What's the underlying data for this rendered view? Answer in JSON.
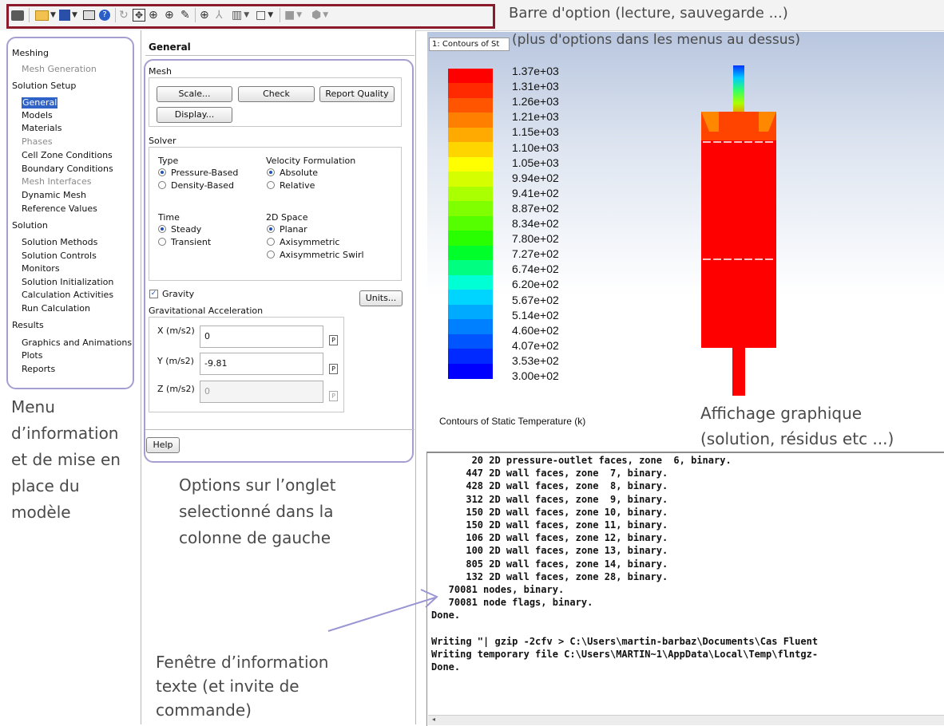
{
  "toolbar": {
    "annotation": "Barre d'option (lecture, sauvegarde ...)",
    "icons": [
      "open-icon",
      "save-icon",
      "screenshot-icon",
      "help-icon",
      "rotate-icon",
      "pan-icon",
      "zoom-fit-icon",
      "zoom-icon",
      "probe-icon",
      "zoom-area-icon",
      "mesh-icon",
      "layout-icon",
      "window-icon",
      "display-icon",
      "view-icon"
    ]
  },
  "nav": {
    "items": [
      {
        "label": "Meshing",
        "kind": "header"
      },
      {
        "label": "Mesh Generation",
        "kind": "dim"
      },
      {
        "label": "Solution Setup",
        "kind": "header"
      },
      {
        "label": "General",
        "kind": "selected"
      },
      {
        "label": "Models",
        "kind": "item"
      },
      {
        "label": "Materials",
        "kind": "item"
      },
      {
        "label": "Phases",
        "kind": "dim"
      },
      {
        "label": "Cell Zone Conditions",
        "kind": "item"
      },
      {
        "label": "Boundary Conditions",
        "kind": "item"
      },
      {
        "label": "Mesh Interfaces",
        "kind": "dim"
      },
      {
        "label": "Dynamic Mesh",
        "kind": "item"
      },
      {
        "label": "Reference Values",
        "kind": "item"
      },
      {
        "label": "Solution",
        "kind": "header"
      },
      {
        "label": "Solution Methods",
        "kind": "item"
      },
      {
        "label": "Solution Controls",
        "kind": "item"
      },
      {
        "label": "Monitors",
        "kind": "item"
      },
      {
        "label": "Solution Initialization",
        "kind": "item"
      },
      {
        "label": "Calculation Activities",
        "kind": "item"
      },
      {
        "label": "Run Calculation",
        "kind": "item"
      },
      {
        "label": "Results",
        "kind": "header"
      },
      {
        "label": "Graphics and Animations",
        "kind": "item"
      },
      {
        "label": "Plots",
        "kind": "item"
      },
      {
        "label": "Reports",
        "kind": "item"
      }
    ],
    "annotation_lines": [
      "Menu",
      "d’information",
      "et de mise en",
      "place du",
      "modèle"
    ]
  },
  "panel": {
    "title": "General",
    "mesh_label": "Mesh",
    "scale_button": "Scale...",
    "check_button": "Check",
    "report_quality_button": "Report Quality",
    "display_button": "Display...",
    "solver_label": "Solver",
    "type_label": "Type",
    "type_pressure": "Pressure-Based",
    "type_density": "Density-Based",
    "velocity_label": "Velocity Formulation",
    "velocity_absolute": "Absolute",
    "velocity_relative": "Relative",
    "time_label": "Time",
    "time_steady": "Steady",
    "time_transient": "Transient",
    "space_label": "2D Space",
    "space_planar": "Planar",
    "space_axisym": "Axisymmetric",
    "space_axisym_swirl": "Axisymmetric Swirl",
    "gravity_label": "Gravity",
    "units_button": "Units...",
    "grav_accel_label": "Gravitational Acceleration",
    "x_label": "X (m/s2)",
    "x_value": "0",
    "y_label": "Y (m/s2)",
    "y_value": "-9.81",
    "z_label": "Z (m/s2)",
    "z_value": "0",
    "p_label": "P",
    "help_button": "Help",
    "annotation_lines": [
      "Options sur l’onglet",
      "selectionné dans la",
      "colonne de gauche"
    ],
    "console_annotation_lines": [
      "Fenêtre d’information",
      "texte (et invite de",
      "commande)"
    ]
  },
  "graphics": {
    "tab_label": "1: Contours of St",
    "annotation": "(plus d'options dans les menus au dessus)",
    "legend_values": [
      "1.37e+03",
      "1.31e+03",
      "1.26e+03",
      "1.21e+03",
      "1.15e+03",
      "1.10e+03",
      "1.05e+03",
      "9.94e+02",
      "9.41e+02",
      "8.87e+02",
      "8.34e+02",
      "7.80e+02",
      "7.27e+02",
      "6.74e+02",
      "6.20e+02",
      "5.67e+02",
      "5.14e+02",
      "4.60e+02",
      "4.07e+02",
      "3.53e+02",
      "3.00e+02"
    ],
    "legend_colors": [
      "#ff0000",
      "#ff2a00",
      "#ff5500",
      "#ff8000",
      "#ffaa00",
      "#ffd500",
      "#ffff00",
      "#d5ff00",
      "#aaff00",
      "#80ff00",
      "#55ff00",
      "#2aff00",
      "#00ff2a",
      "#00ff80",
      "#00ffd5",
      "#00d5ff",
      "#00aaff",
      "#0080ff",
      "#0055ff",
      "#002aff",
      "#0000ff"
    ],
    "caption": "Contours of Static Temperature (k)",
    "annotation2_lines": [
      "Affichage graphique",
      "(solution, résidus etc ...)"
    ]
  },
  "console": {
    "lines": [
      "       20 2D pressure-outlet faces, zone  6, binary.",
      "      447 2D wall faces, zone  7, binary.",
      "      428 2D wall faces, zone  8, binary.",
      "      312 2D wall faces, zone  9, binary.",
      "      150 2D wall faces, zone 10, binary.",
      "      150 2D wall faces, zone 11, binary.",
      "      106 2D wall faces, zone 12, binary.",
      "      100 2D wall faces, zone 13, binary.",
      "      805 2D wall faces, zone 14, binary.",
      "      132 2D wall faces, zone 28, binary.",
      "   70081 nodes, binary.",
      "   70081 node flags, binary.",
      "Done.",
      "",
      "Writing \"| gzip -2cfv > C:\\Users\\martin-barbaz\\Documents\\Cas Fluent",
      "Writing temporary file C:\\Users\\MARTIN~1\\AppData\\Local\\Temp\\flntgz-",
      "Done."
    ]
  }
}
